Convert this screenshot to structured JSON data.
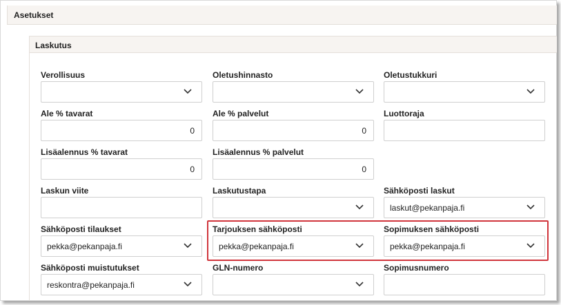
{
  "panel": {
    "title": "Asetukset"
  },
  "section": {
    "title": "Laskutus"
  },
  "fields": {
    "verollisuus": {
      "label": "Verollisuus",
      "value": ""
    },
    "oletushinnasto": {
      "label": "Oletushinnasto",
      "value": ""
    },
    "oletustukkuri": {
      "label": "Oletustukkuri",
      "value": ""
    },
    "ale_tavarat": {
      "label": "Ale % tavarat",
      "value": "0"
    },
    "ale_palvelut": {
      "label": "Ale % palvelut",
      "value": "0"
    },
    "luottoraja": {
      "label": "Luottoraja",
      "value": ""
    },
    "lisaalennus_tavarat": {
      "label": "Lisäalennus % tavarat",
      "value": "0"
    },
    "lisaalennus_palvelut": {
      "label": "Lisäalennus % palvelut",
      "value": "0"
    },
    "laskun_viite": {
      "label": "Laskun viite",
      "value": ""
    },
    "laskutustapa": {
      "label": "Laskutustapa",
      "value": ""
    },
    "sahkoposti_laskut": {
      "label": "Sähköposti laskut",
      "value": "laskut@pekanpaja.fi"
    },
    "sahkoposti_tilaukset": {
      "label": "Sähköposti tilaukset",
      "value": "pekka@pekanpaja.fi"
    },
    "tarjouksen_sahkoposti": {
      "label": "Tarjouksen sähköposti",
      "value": "pekka@pekanpaja.fi"
    },
    "sopimuksen_sahkoposti": {
      "label": "Sopimuksen sähköposti",
      "value": "pekka@pekanpaja.fi"
    },
    "sahkoposti_muistutukset": {
      "label": "Sähköposti muistutukset",
      "value": "reskontra@pekanpaja.fi"
    },
    "gln_numero": {
      "label": "GLN-numero",
      "value": ""
    },
    "sopimusnumero": {
      "label": "Sopimusnumero",
      "value": ""
    }
  },
  "icons": {
    "dropdown": "chevron-down-icon"
  },
  "colors": {
    "highlight": "#d0343b",
    "header_bg": "#f7f4f1"
  }
}
